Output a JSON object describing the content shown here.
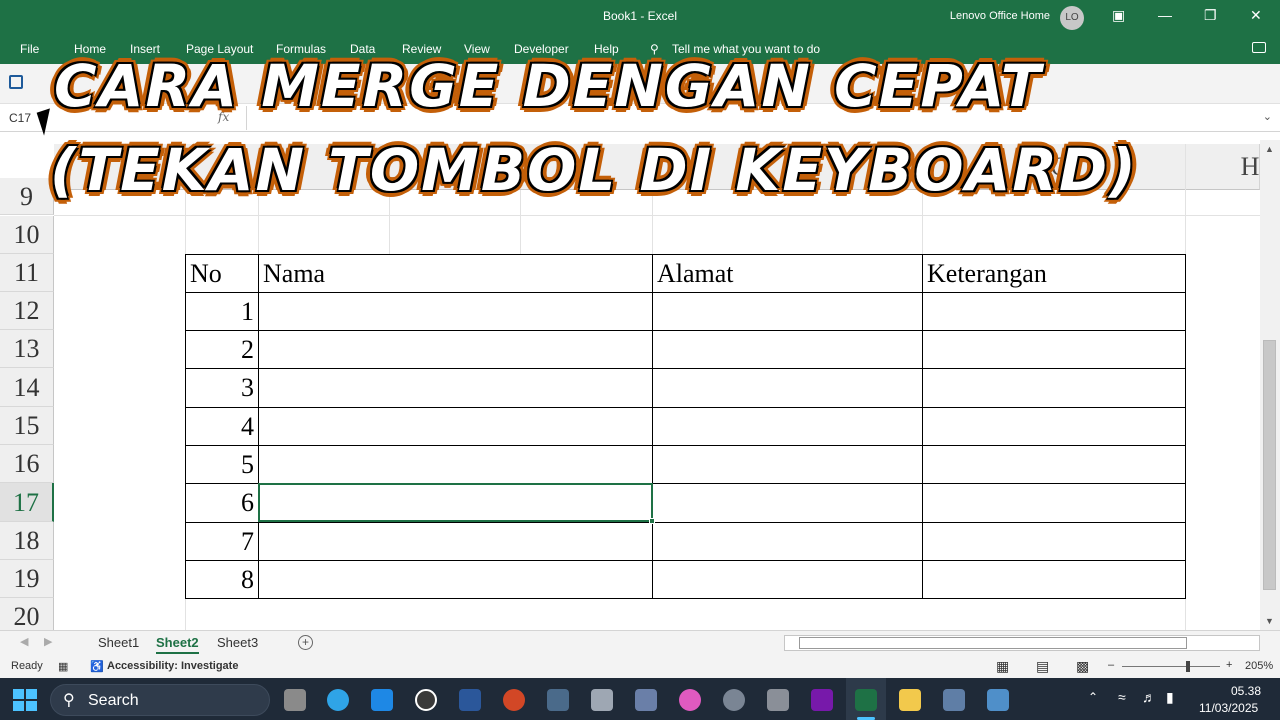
{
  "window": {
    "title": "Book1  -  Excel",
    "user_name": "Lenovo Office Home",
    "avatar_initials": "LO",
    "accent_color": "#1e7145"
  },
  "ribbon": {
    "file": "File",
    "tabs": [
      "Home",
      "Insert",
      "Page Layout",
      "Formulas",
      "Data",
      "Review",
      "View",
      "Developer",
      "Help"
    ],
    "tell_me": "Tell me what you want to do"
  },
  "formula_bar": {
    "name_box": "C17",
    "fx_label": "fx",
    "value": ""
  },
  "overlay": {
    "line1": "CARA  MERGE  DENGAN  CEPAT",
    "line2": "(TEKAN  TOMBOL  DI  KEYBOARD)"
  },
  "sheet": {
    "column_headers": {
      "e": "E",
      "g": "G",
      "h": "H"
    },
    "row_numbers": [
      "9",
      "10",
      "11",
      "12",
      "13",
      "14",
      "15",
      "16",
      "17",
      "18",
      "19",
      "20"
    ],
    "active_row": "17",
    "table": {
      "headers": [
        "No",
        "Nama",
        "Alamat",
        "Keterangan"
      ],
      "rows": [
        [
          "1",
          "",
          "",
          ""
        ],
        [
          "2",
          "",
          "",
          ""
        ],
        [
          "3",
          "",
          "",
          ""
        ],
        [
          "4",
          "",
          "",
          ""
        ],
        [
          "5",
          "",
          "",
          ""
        ],
        [
          "6",
          "",
          "",
          ""
        ],
        [
          "7",
          "",
          "",
          ""
        ],
        [
          "8",
          "",
          "",
          ""
        ]
      ]
    }
  },
  "sheet_tabs": {
    "tabs": [
      "Sheet1",
      "Sheet2",
      "Sheet3"
    ],
    "active": "Sheet2"
  },
  "status_bar": {
    "ready": "Ready",
    "accessibility": "Accessibility: Investigate",
    "zoom": "205%"
  },
  "taskbar": {
    "search_label": "Search",
    "time": "05.38",
    "date": "11/03/2025"
  }
}
